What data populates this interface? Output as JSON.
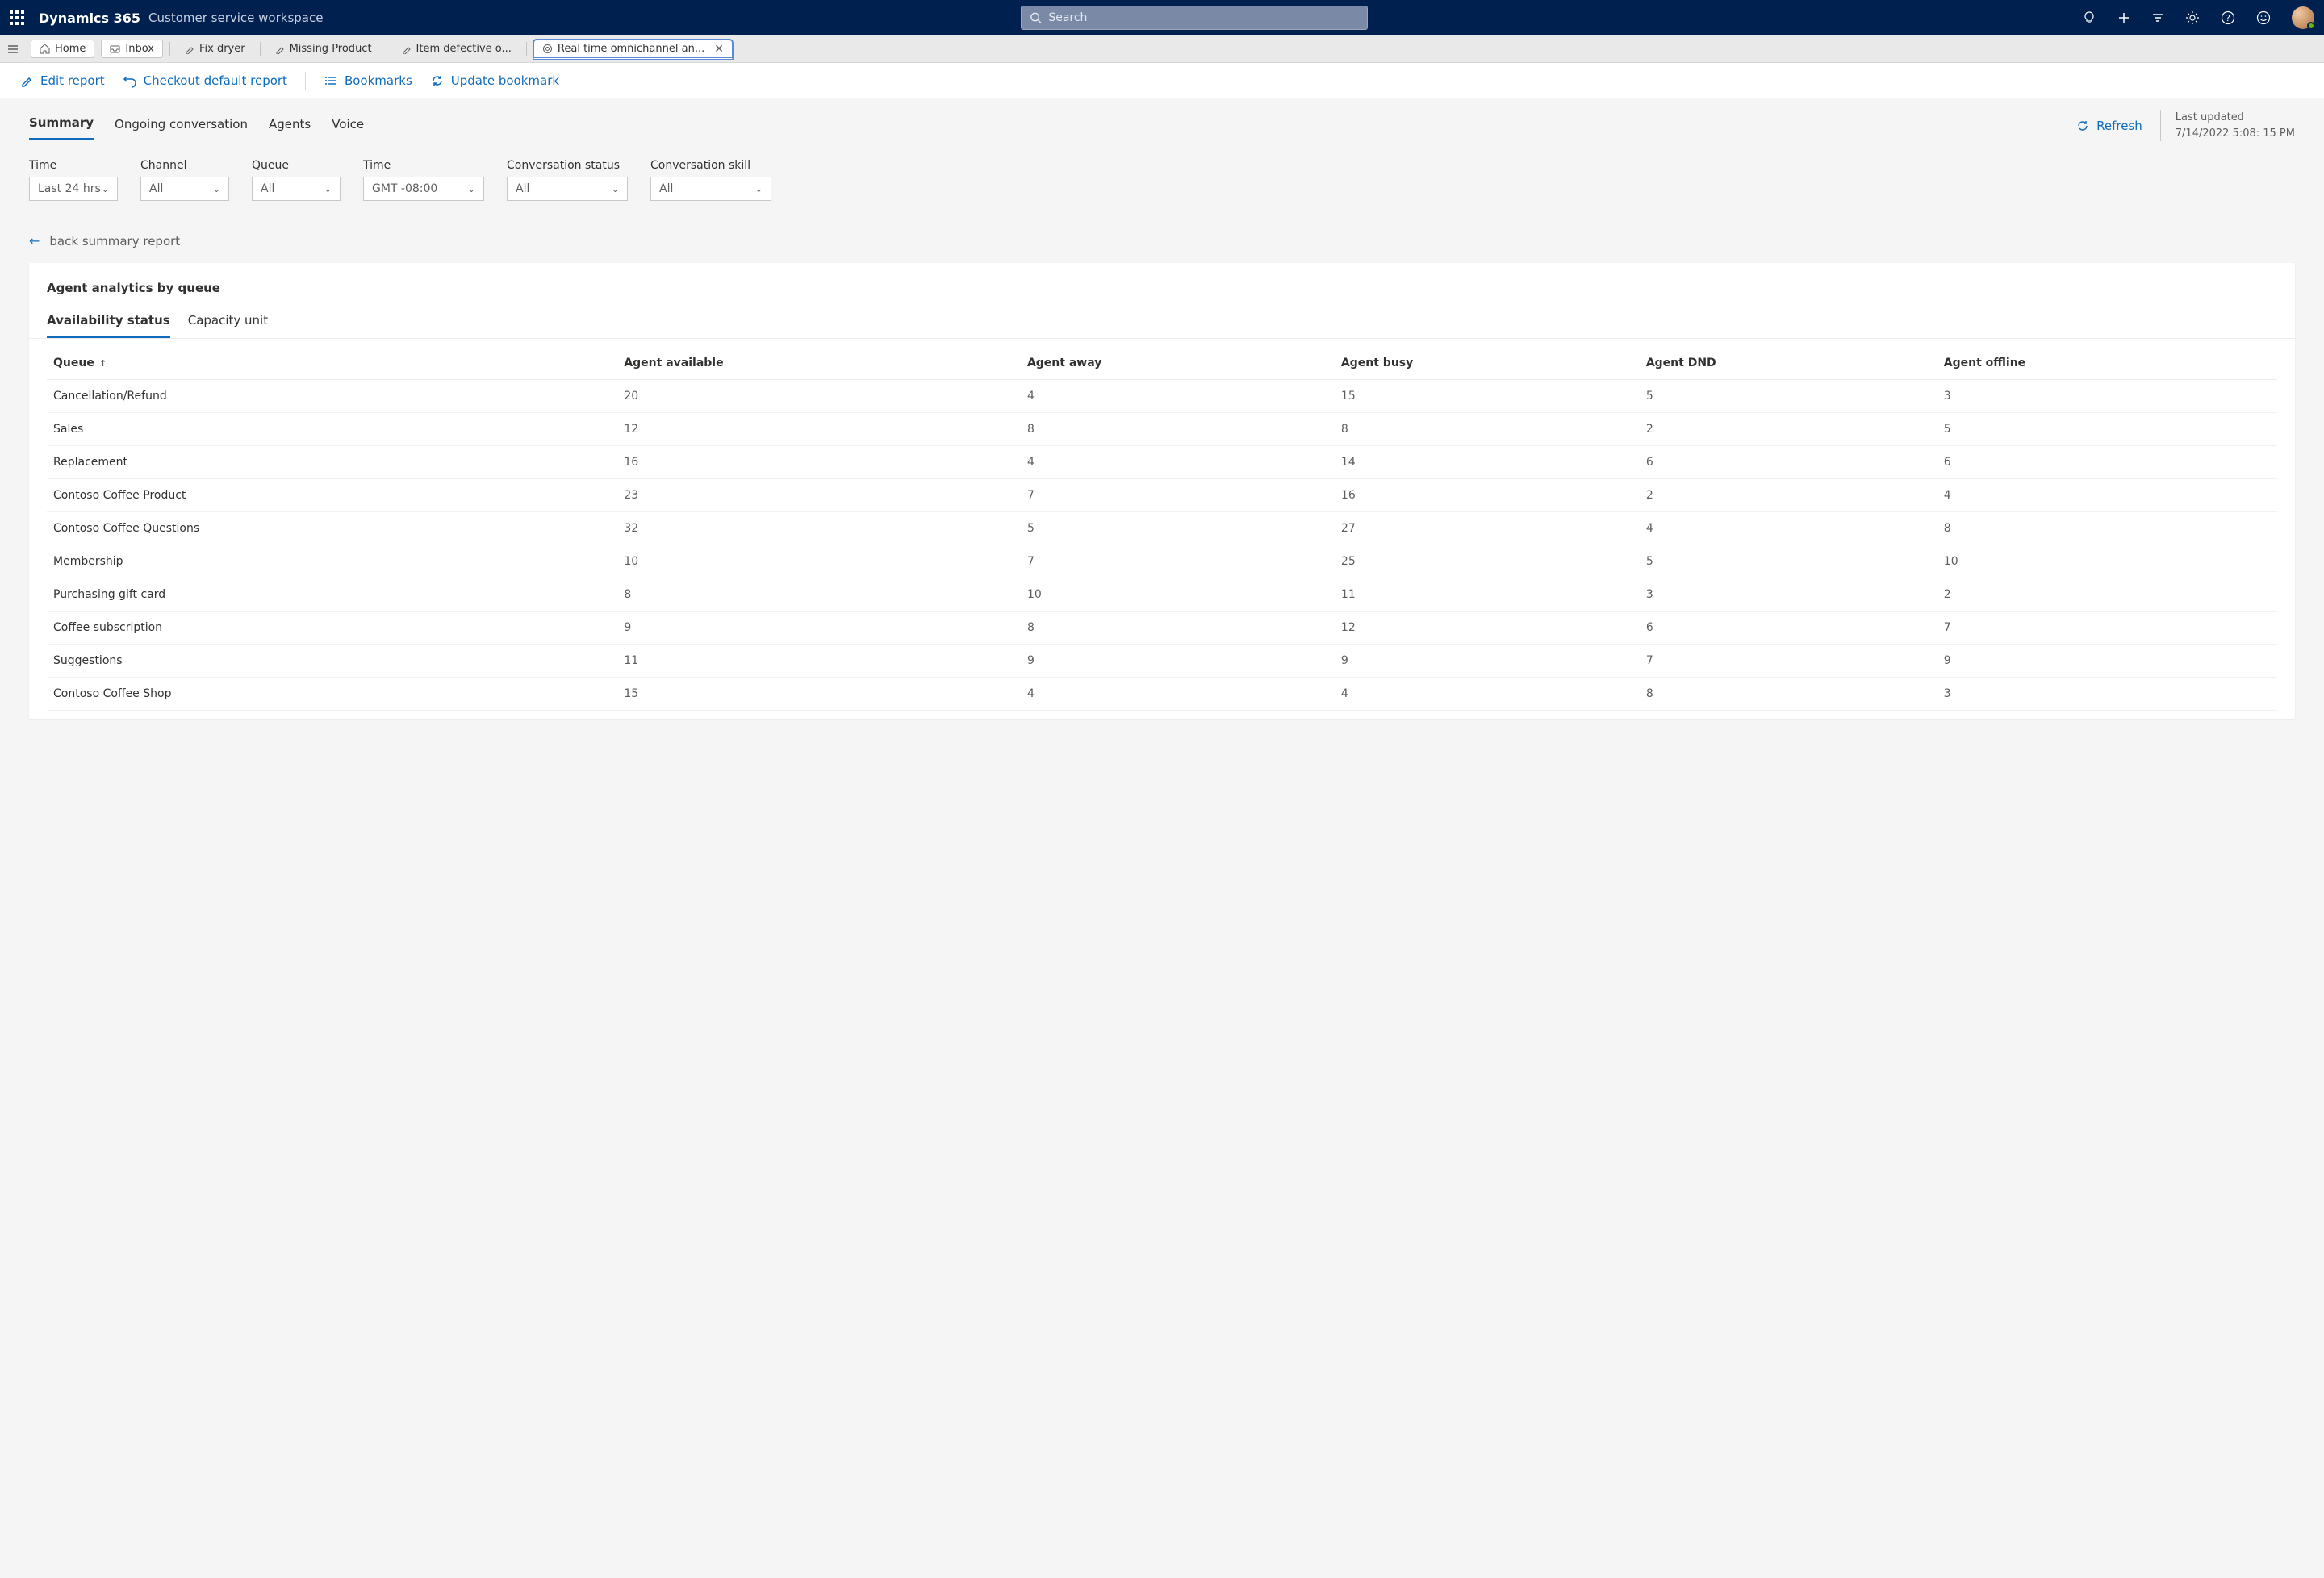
{
  "header": {
    "brand": "Dynamics 365",
    "subbrand": "Customer service workspace",
    "search_placeholder": "Search"
  },
  "tabs": {
    "home": "Home",
    "inbox": "Inbox",
    "items": [
      {
        "label": "Fix dryer"
      },
      {
        "label": "Missing Product"
      },
      {
        "label": "Item defective o..."
      },
      {
        "label": "Real time omnichannel an..."
      }
    ]
  },
  "cmd": {
    "edit": "Edit report",
    "checkout": "Checkout default report",
    "bookmarks": "Bookmarks",
    "update": "Update bookmark"
  },
  "reporttabs": [
    "Summary",
    "Ongoing conversation",
    "Agents",
    "Voice"
  ],
  "refresh_label": "Refresh",
  "last_updated_label": "Last updated",
  "last_updated_value": "7/14/2022 5:08: 15 PM",
  "filters": [
    {
      "label": "Time",
      "value": "Last 24 hrs"
    },
    {
      "label": "Channel",
      "value": "All"
    },
    {
      "label": "Queue",
      "value": "All"
    },
    {
      "label": "Time",
      "value": "GMT -08:00",
      "wide": true
    },
    {
      "label": "Conversation status",
      "value": "All",
      "wide": true
    },
    {
      "label": "Conversation skill",
      "value": "All",
      "wide": true
    }
  ],
  "back_label": "back summary report",
  "card": {
    "title": "Agent analytics by queue",
    "subtabs": [
      "Availability status",
      "Capacity unit"
    ],
    "columns": [
      "Queue",
      "Agent available",
      "Agent away",
      "Agent busy",
      "Agent DND",
      "Agent offline"
    ],
    "rows": [
      {
        "queue": "Cancellation/Refund",
        "available": 20,
        "away": 4,
        "busy": 15,
        "dnd": 5,
        "offline": 3
      },
      {
        "queue": "Sales",
        "available": 12,
        "away": 8,
        "busy": 8,
        "dnd": 2,
        "offline": 5
      },
      {
        "queue": "Replacement",
        "available": 16,
        "away": 4,
        "busy": 14,
        "dnd": 6,
        "offline": 6
      },
      {
        "queue": "Contoso Coffee Product",
        "available": 23,
        "away": 7,
        "busy": 16,
        "dnd": 2,
        "offline": 4
      },
      {
        "queue": "Contoso Coffee Questions",
        "available": 32,
        "away": 5,
        "busy": 27,
        "dnd": 4,
        "offline": 8
      },
      {
        "queue": "Membership",
        "available": 10,
        "away": 7,
        "busy": 25,
        "dnd": 5,
        "offline": 10
      },
      {
        "queue": "Purchasing gift card",
        "available": 8,
        "away": 10,
        "busy": 11,
        "dnd": 3,
        "offline": 2
      },
      {
        "queue": "Coffee subscription",
        "available": 9,
        "away": 8,
        "busy": 12,
        "dnd": 6,
        "offline": 7
      },
      {
        "queue": "Suggestions",
        "available": 11,
        "away": 9,
        "busy": 9,
        "dnd": 7,
        "offline": 9
      },
      {
        "queue": "Contoso Coffee Shop",
        "available": 15,
        "away": 4,
        "busy": 4,
        "dnd": 8,
        "offline": 3
      }
    ]
  }
}
